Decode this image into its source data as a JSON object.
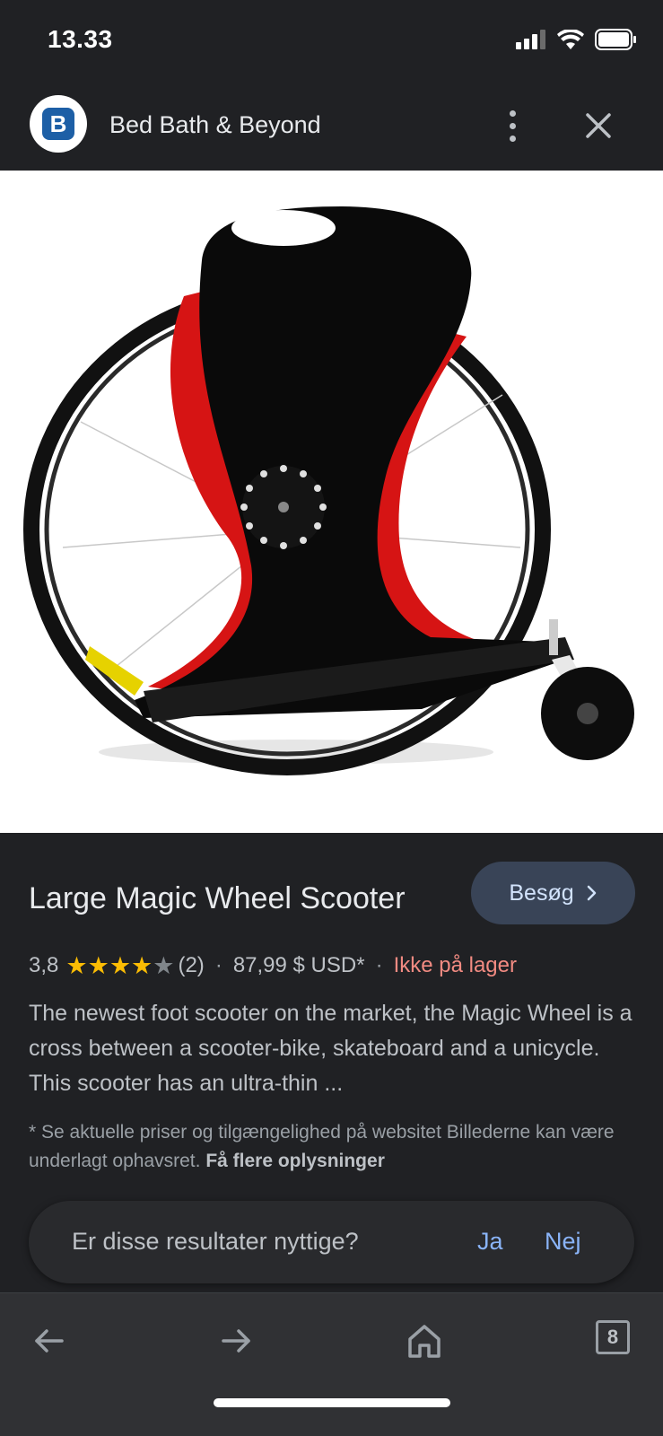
{
  "status": {
    "time": "13.33"
  },
  "header": {
    "logo_letter": "B",
    "site_name": "Bed Bath & Beyond"
  },
  "product": {
    "title": "Large Magic Wheel Scooter",
    "visit_label": "Besøg",
    "rating": "3,8",
    "rating_value": 3.8,
    "rating_max": 5,
    "review_count": "(2)",
    "price": "87,99 $ USD*",
    "stock": "Ikke på lager",
    "description": "The newest foot scooter on the market, the Magic Wheel is a cross between a scooter-bike, skateboard and a unicycle. This scooter has an ultra-thin ...",
    "disclaimer": "* Se aktuelle priser og tilgængelighed på websitet Billederne kan være underlagt ophavsret.",
    "more_info": "Få flere oplysninger"
  },
  "feedback": {
    "question": "Er disse resultater nyttige?",
    "yes": "Ja",
    "no": "Nej"
  },
  "toolbar": {
    "tab_count": "8"
  },
  "colors": {
    "stars": "#fbbc04",
    "stock": "#f28b82",
    "link": "#8ab4f8",
    "brand": "#1d5fa6"
  }
}
